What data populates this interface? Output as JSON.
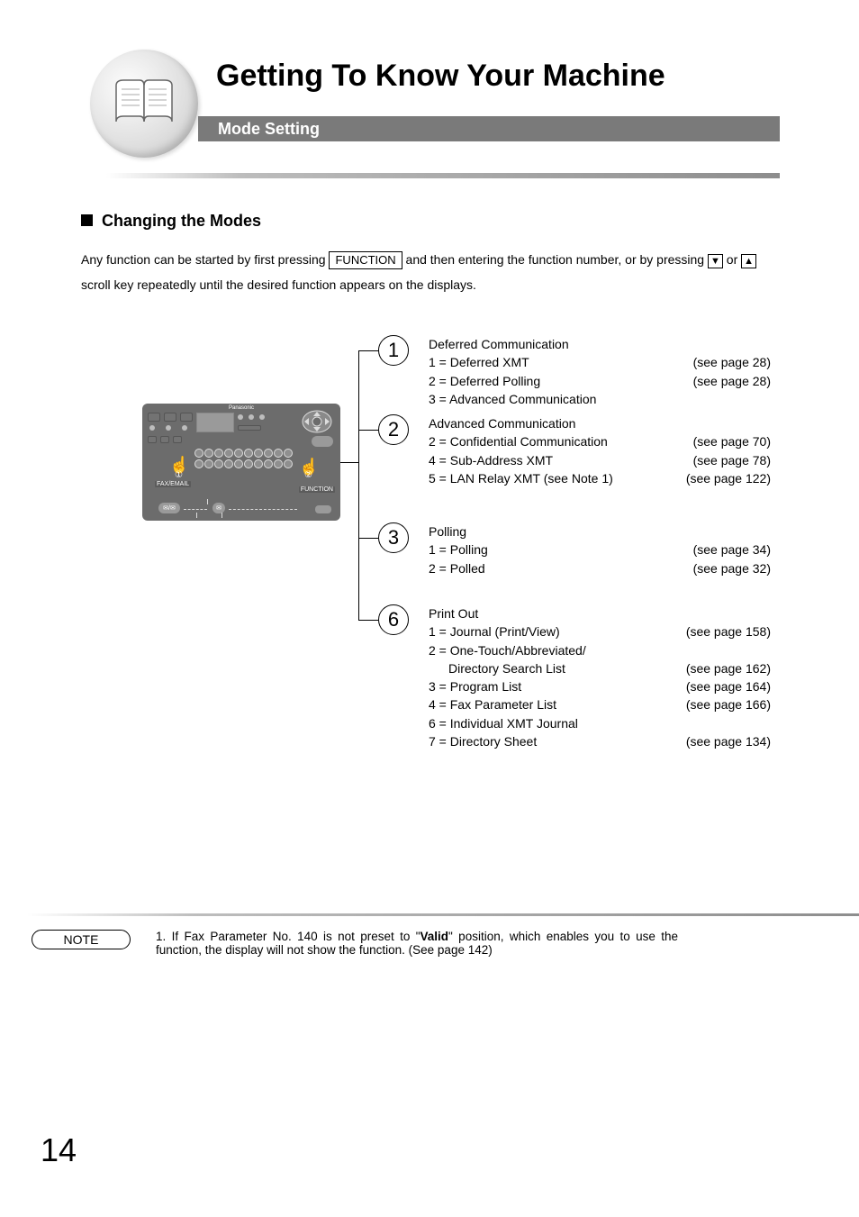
{
  "header": {
    "title": "Getting To Know Your Machine",
    "banner": "Mode Setting"
  },
  "section": {
    "heading": "Changing the Modes",
    "intro_part1": "Any function can be started by first pressing ",
    "function_key": "FUNCTION",
    "intro_part2": " and then entering the function number, or by pressing ",
    "down_icon": "▼",
    "intro_part3": " or ",
    "up_icon": "▲",
    "intro_part4": " scroll key repeatedly until the desired function appears on the displays."
  },
  "panel": {
    "brand": "Panasonic",
    "fax_email_label": "FAX/EMAIL",
    "circle1": "①",
    "circle2": "②",
    "function_label": "FUNCTION"
  },
  "nodes": {
    "n1": "1",
    "n2": "2",
    "n3": "3",
    "n6": "6"
  },
  "funcs": {
    "f1": {
      "title": "Deferred Communication",
      "rows": [
        {
          "l": "1 = Deferred XMT",
          "r": "(see page 28)"
        },
        {
          "l": "2 = Deferred Polling",
          "r": "(see page 28)"
        },
        {
          "l": "3 = Advanced Communication",
          "r": ""
        }
      ]
    },
    "f2": {
      "title": "Advanced Communication",
      "rows": [
        {
          "l": "2 = Confidential Communication",
          "r": "(see page 70)"
        },
        {
          "l": "4 = Sub-Address XMT",
          "r": "(see page 78)"
        },
        {
          "l": "5 = LAN Relay XMT (see Note 1)",
          "r": "(see page 122)"
        }
      ]
    },
    "f3": {
      "title": "Polling",
      "rows": [
        {
          "l": "1 = Polling",
          "r": "(see page 34)"
        },
        {
          "l": "2 = Polled",
          "r": "(see page 32)"
        }
      ]
    },
    "f6": {
      "title": "Print Out",
      "rows": [
        {
          "l": "1 = Journal (Print/View)",
          "r": "(see page 158)"
        },
        {
          "l": "2 = One-Touch/Abbreviated/",
          "r": ""
        },
        {
          "l_indent": "Directory Search List",
          "r": "(see page 162)"
        },
        {
          "l": "3 = Program List",
          "r": "(see page 164)"
        },
        {
          "l": "4 = Fax Parameter List",
          "r": "(see page 166)"
        },
        {
          "l": "6 = Individual XMT Journal",
          "r": ""
        },
        {
          "l": "7 = Directory Sheet",
          "r": "(see page 134)"
        }
      ]
    }
  },
  "note": {
    "pill": "NOTE",
    "text_prefix": "1. If Fax Parameter No. 140 is not preset to \"",
    "bold": "Valid",
    "text_suffix": "\" position, which enables you to use the function, the display will not show the function. (See page 142)"
  },
  "page_number": "14"
}
